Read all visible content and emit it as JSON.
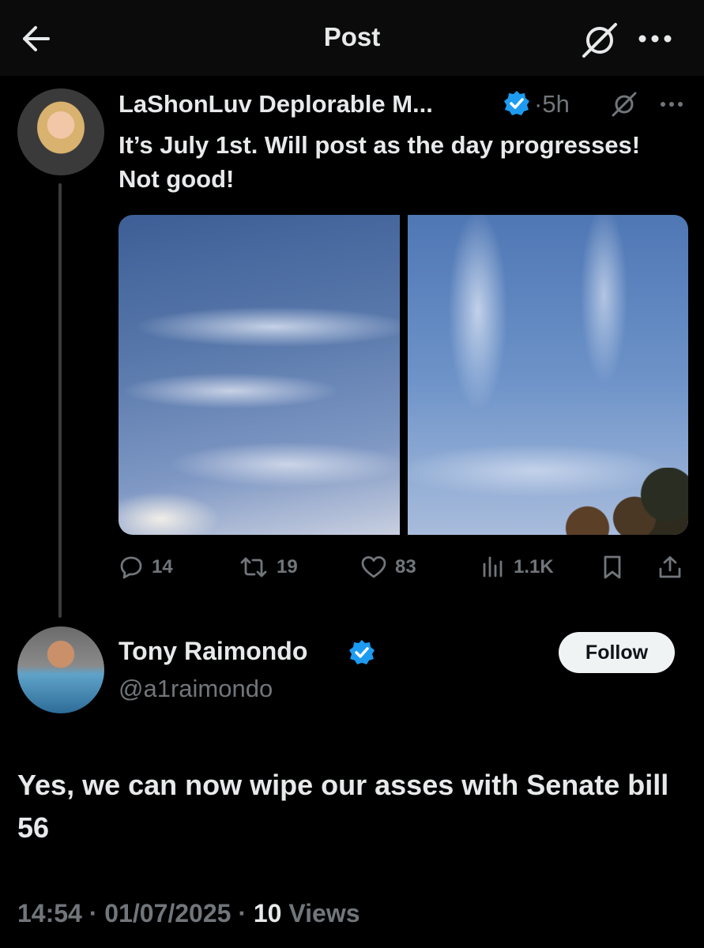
{
  "header": {
    "title": "Post"
  },
  "original_post": {
    "author_name": "LaShonLuv Deplorable M...",
    "time_sep": "·",
    "time": "5h",
    "text": "It’s July 1st. Will post as the day progresses! Not good!",
    "stats": {
      "replies": "14",
      "reposts": "19",
      "likes": "83",
      "views": "1.1K"
    }
  },
  "reply": {
    "author_name": "Tony Raimondo",
    "handle": "@a1raimondo",
    "follow_label": "Follow",
    "text": "Yes, we can now wipe our asses with Senate bill 56",
    "time": "14:54",
    "sep": "·",
    "date": "01/07/2025",
    "views_count": "10",
    "views_label": "Views"
  },
  "icons": {
    "back": "arrow-left-icon",
    "grok": "grok-icon",
    "more": "more-horizontal-icon",
    "verified": "verified-badge-icon",
    "reply": "reply-icon",
    "repost": "repost-icon",
    "like": "heart-icon",
    "views": "views-chart-icon",
    "bookmark": "bookmark-icon",
    "share": "share-icon"
  },
  "colors": {
    "background": "#000000",
    "text": "#e7e9ea",
    "muted": "#71767b",
    "verified": "#1d9bf0"
  }
}
